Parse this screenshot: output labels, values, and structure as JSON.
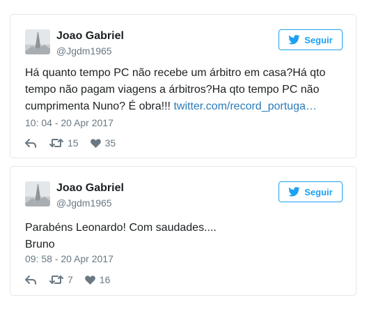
{
  "tweets": [
    {
      "author": {
        "name": "Joao Gabriel",
        "handle": "@Jgdm1965"
      },
      "follow_label": "Seguir",
      "text_lines": [
        "Há quanto tempo PC não recebe um árbitro em casa?Há qto",
        "tempo não pagam viagens a árbitros?Ha qto tempo PC não"
      ],
      "text_last_prefix": "cumprimenta Nuno? É obra!!! ",
      "link_text": "twitter.com/record_portuga…",
      "timestamp": "10: 04 - 20 Apr 2017",
      "retweets": "15",
      "likes": "35"
    },
    {
      "author": {
        "name": "Joao Gabriel",
        "handle": "@Jgdm1965"
      },
      "follow_label": "Seguir",
      "text_lines": [
        "Parabéns Leonardo! Com saudades....",
        "Bruno"
      ],
      "timestamp": "09: 58 - 20 Apr 2017",
      "retweets": "7",
      "likes": "16"
    }
  ],
  "icons": {
    "brand_color": "#1da1f2",
    "link_color": "#2b7bb9",
    "muted_color": "#697882",
    "follow_icon": "twitter-bird-icon",
    "actions": [
      "reply-icon",
      "retweet-icon",
      "heart-icon"
    ]
  }
}
